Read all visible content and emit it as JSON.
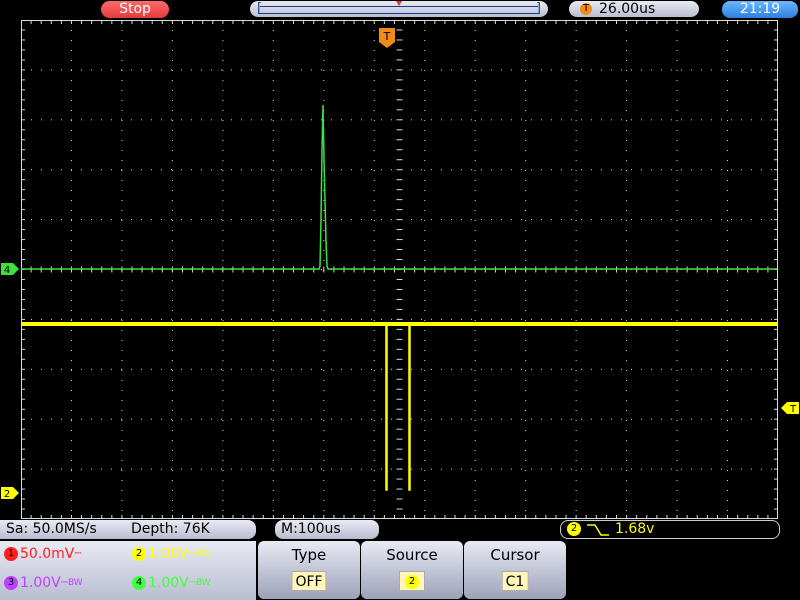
{
  "header": {
    "run_state": "Stop",
    "horizontal_position": "26.00us",
    "trigger_badge": "T",
    "clock": "21:19",
    "memory_left_bracket": "[",
    "memory_right_bracket": "]"
  },
  "markers": {
    "ch4": "4",
    "ch2": "2",
    "trigger_level": "T",
    "trigger_position": "T"
  },
  "status": {
    "sample_rate": "Sa: 50.0MS/s",
    "depth": "Depth: 76K",
    "timebase": "M:100us",
    "trigger_source_badge": "2",
    "trigger_level": "1.68v"
  },
  "channels": [
    {
      "badge": "1",
      "scale": "50.0mV",
      "coupling": "⎓",
      "bw": "",
      "color": "#ff2020"
    },
    {
      "badge": "2",
      "scale": "1.00V",
      "coupling": "⎓",
      "bw": "BW",
      "color": "#ffff00"
    },
    {
      "badge": "3",
      "scale": "1.00V",
      "coupling": "⎓",
      "bw": "BW",
      "color": "#c040ff"
    },
    {
      "badge": "4",
      "scale": "1.00V",
      "coupling": "⎓",
      "bw": "BW",
      "color": "#40ff40"
    }
  ],
  "menu": [
    {
      "label": "Type",
      "value": "OFF"
    },
    {
      "label": "Source",
      "value": "2"
    },
    {
      "label": "Cursor",
      "value": "C1"
    }
  ],
  "colors": {
    "ch4_trace": "#3ee03e",
    "ch2_trace": "#ffff00",
    "trigger": "#f28a1a",
    "grid": "#d8d8d8"
  }
}
